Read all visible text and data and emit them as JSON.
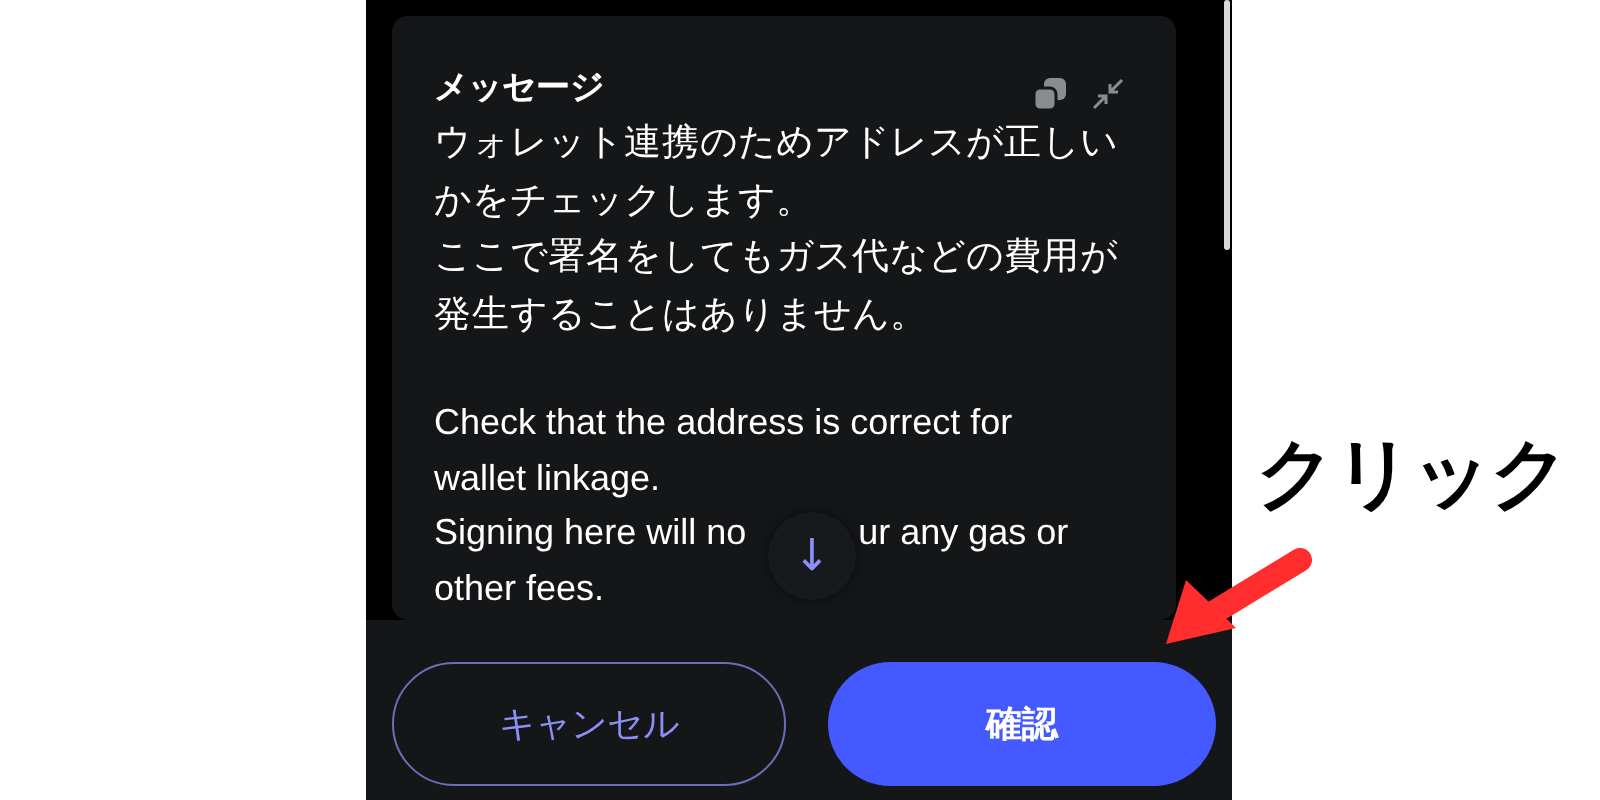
{
  "message": {
    "title": "メッセージ",
    "ja_lines": [
      "ウォレット連携のためアドレスが正しい",
      "かをチェックします。",
      "ここで署名をしてもガス代などの費用が",
      "発生することはありません。"
    ],
    "en_lines": [
      [
        "Check that the address is correct for"
      ],
      [
        "wallet linkage."
      ],
      [
        "Signing here will no",
        "ur any gas or"
      ],
      [
        "other fees."
      ]
    ]
  },
  "scroll_button": {
    "glyph": "↓"
  },
  "buttons": [
    {
      "label": "キャンセル",
      "kind": "secondary"
    },
    {
      "label": "確認",
      "kind": "primary"
    }
  ],
  "annotation": {
    "label": "クリック"
  }
}
